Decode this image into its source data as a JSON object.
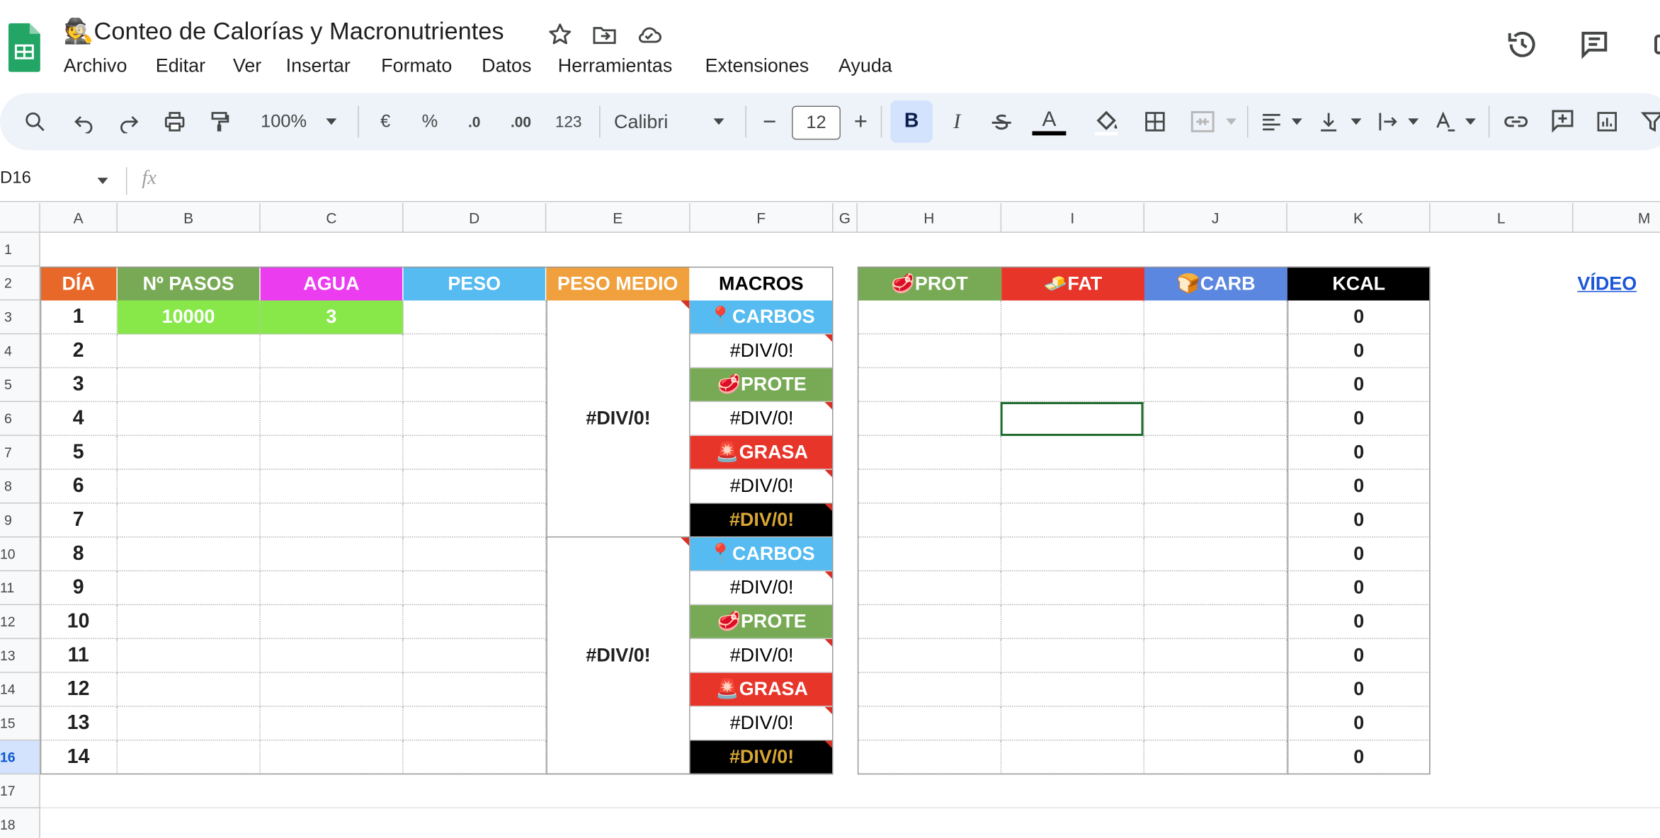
{
  "app": {
    "title": "Conteo de Calorías y Macronutrientes",
    "title_emoji": "🕵️"
  },
  "menu": [
    "Archivo",
    "Editar",
    "Ver",
    "Insertar",
    "Formato",
    "Datos",
    "Herramientas",
    "Extensiones",
    "Ayuda"
  ],
  "toolbar": {
    "zoom": "100%",
    "currency": "€",
    "percent": "%",
    "dec_decrease": ".0",
    "dec_increase": ".00",
    "format_number": "123",
    "font": "Calibri",
    "font_size": "12",
    "minus": "−",
    "plus": "+",
    "bold": "B",
    "italic": "I",
    "text_color_letter": "A"
  },
  "formula_bar": {
    "cell_ref": "D16",
    "fx": "fx"
  },
  "columns": [
    "A",
    "B",
    "C",
    "D",
    "E",
    "F",
    "G",
    "H",
    "I",
    "J",
    "K",
    "L",
    "M"
  ],
  "rows": [
    "1",
    "2",
    "3",
    "4",
    "5",
    "6",
    "7",
    "8",
    "9",
    "10",
    "11",
    "12",
    "13",
    "14",
    "15",
    "16",
    "17",
    "18"
  ],
  "headers": {
    "dia": "DÍA",
    "pasos": "Nº PASOS",
    "agua": "AGUA",
    "peso": "PESO",
    "peso_medio": "PESO MEDIO",
    "macros": "MACROS",
    "prot": "PROT",
    "fat": "FAT",
    "carb": "CARB",
    "kcal": "KCAL",
    "video": "VÍDEO",
    "prot_icon": "🥩",
    "fat_icon": "🧈",
    "carb_icon": "🍞"
  },
  "days": [
    "1",
    "2",
    "3",
    "4",
    "5",
    "6",
    "7",
    "8",
    "9",
    "10",
    "11",
    "12",
    "13",
    "14"
  ],
  "pasos_first": "10000",
  "agua_first": "3",
  "peso_medio": [
    "#DIV/0!",
    "#DIV/0!"
  ],
  "macros": [
    {
      "label": "CARBOS",
      "icon": "📍"
    },
    {
      "label": "#DIV/0!"
    },
    {
      "label": "PROTE",
      "icon": "🥩"
    },
    {
      "label": "#DIV/0!"
    },
    {
      "label": "GRASA",
      "icon": "🚨"
    },
    {
      "label": "#DIV/0!"
    },
    {
      "label": "#DIV/0!"
    },
    {
      "label": "CARBOS",
      "icon": "📍"
    },
    {
      "label": "#DIV/0!"
    },
    {
      "label": "PROTE",
      "icon": "🥩"
    },
    {
      "label": "#DIV/0!"
    },
    {
      "label": "GRASA",
      "icon": "🚨"
    },
    {
      "label": "#DIV/0!"
    },
    {
      "label": "#DIV/0!"
    }
  ],
  "kcal": [
    "0",
    "0",
    "0",
    "0",
    "0",
    "0",
    "0",
    "0",
    "0",
    "0",
    "0",
    "0",
    "0",
    "0"
  ],
  "colors": {
    "dia": "#e8682a",
    "pasos": "#78aa55",
    "agua": "#ec3cf0",
    "peso": "#55bbf0",
    "peso_medio": "#f0a03c",
    "carbos": "#55bbf0",
    "prote": "#78aa55",
    "grasa": "#e8352a",
    "black": "#000000",
    "gold": "#d8a735",
    "green_fill": "#88e84a",
    "carb_hdr": "#5b87e0",
    "selection": "#1e6b2e",
    "link": "#1a56d8"
  }
}
